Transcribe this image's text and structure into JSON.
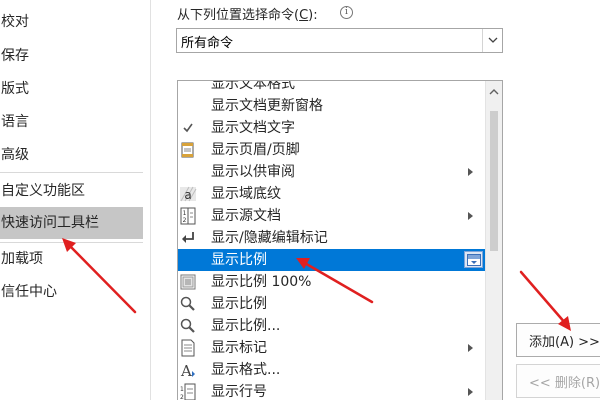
{
  "nav": {
    "items": [
      {
        "label": "校对",
        "selected": false
      },
      {
        "label": "保存",
        "selected": false
      },
      {
        "label": "版式",
        "selected": false
      },
      {
        "label": "语言",
        "selected": false
      },
      {
        "label": "高级",
        "selected": false
      },
      {
        "label": "自定义功能区",
        "selected": false
      },
      {
        "label": "快速访问工具栏",
        "selected": true
      },
      {
        "label": "加载项",
        "selected": false
      },
      {
        "label": "信任中心",
        "selected": false
      }
    ]
  },
  "command_source": {
    "label_prefix": "从下列位置选择命令(",
    "label_key": "C",
    "label_suffix": "):",
    "info_icon": "info-icon",
    "selected_value": "所有命令"
  },
  "commands": [
    {
      "label": "显示文本格式",
      "icon": "format-icon",
      "submenu": false
    },
    {
      "label": "显示文档更新窗格",
      "icon": "",
      "submenu": false
    },
    {
      "label": "显示文档文字",
      "icon": "checkmark-icon",
      "submenu": false
    },
    {
      "label": "显示页眉/页脚",
      "icon": "header-footer-icon",
      "submenu": false
    },
    {
      "label": "显示以供审阅",
      "icon": "",
      "submenu": true
    },
    {
      "label": "显示域底纹",
      "icon": "field-shading-icon",
      "submenu": false
    },
    {
      "label": "显示源文档",
      "icon": "source-document-icon",
      "submenu": true
    },
    {
      "label": "显示/隐藏编辑标记",
      "icon": "edit-mark-icon",
      "submenu": false
    },
    {
      "label": "显示比例",
      "icon": "",
      "submenu": false,
      "selected": true,
      "combo": true
    },
    {
      "label": "显示比例 100%",
      "icon": "zoom-100-icon",
      "submenu": false
    },
    {
      "label": "显示比例",
      "icon": "magnifier-icon",
      "submenu": false
    },
    {
      "label": "显示比例...",
      "icon": "magnifier-icon",
      "submenu": false
    },
    {
      "label": "显示标记",
      "icon": "markup-icon",
      "submenu": true
    },
    {
      "label": "显示格式...",
      "icon": "show-format-icon",
      "submenu": false
    },
    {
      "label": "显示行号",
      "icon": "line-number-icon",
      "submenu": true
    }
  ],
  "buttons": {
    "add_label": "添加(A) >>",
    "remove_label": "<< 删除(R)"
  },
  "colors": {
    "selection": "#0078d7",
    "nav_selected": "#c6c6c6",
    "annotation_arrow": "#e02020"
  }
}
